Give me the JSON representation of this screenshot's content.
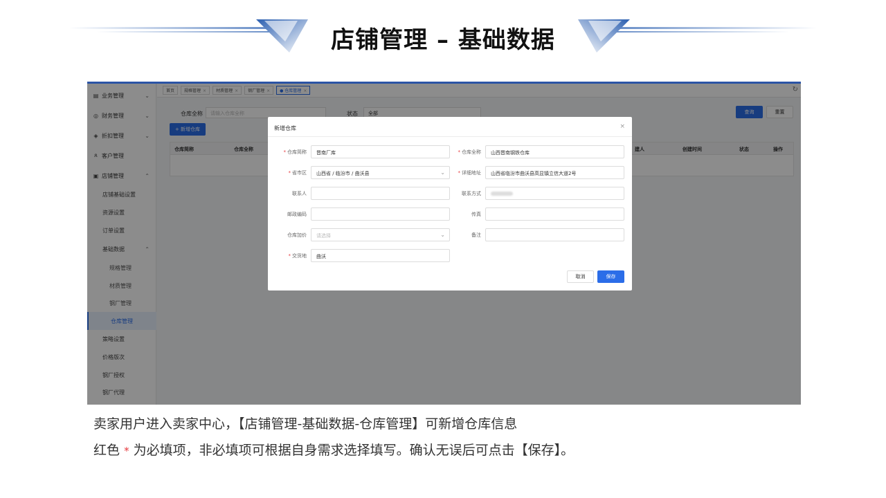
{
  "slide": {
    "title": "店铺管理 – 基础数据",
    "caption_line1": "卖家用户进入卖家中心，【店铺管理-基础数据-仓库管理】可新增仓库信息",
    "caption_line2_prefix": "红色",
    "caption_line2_star": "*",
    "caption_line2_suffix": "为必填项，非必填项可根据自身需求选择填写。确认无误后可点击【保存】。"
  },
  "sidebar": {
    "items": [
      {
        "label": "业务管理",
        "icon": "clipboard-icon",
        "chevron": "⌄"
      },
      {
        "label": "财务管理",
        "icon": "money-icon",
        "chevron": "⌄"
      },
      {
        "label": "折扣管理",
        "icon": "tag-icon",
        "chevron": "⌄"
      },
      {
        "label": "客户管理",
        "icon": "users-icon"
      },
      {
        "label": "店铺管理",
        "icon": "store-icon",
        "chevron": "⌃"
      },
      {
        "label": "店铺基础设置"
      },
      {
        "label": "资源设置"
      },
      {
        "label": "订单设置"
      },
      {
        "label": "基础数据",
        "chevron": "⌃"
      },
      {
        "label": "规格管理"
      },
      {
        "label": "材质管理"
      },
      {
        "label": "钢厂管理"
      },
      {
        "label": "仓库管理"
      },
      {
        "label": "策略设置"
      },
      {
        "label": "价格版次"
      },
      {
        "label": "钢厂授权"
      },
      {
        "label": "钢厂代理"
      }
    ]
  },
  "tabs": [
    {
      "label": "首页"
    },
    {
      "label": "规格管理",
      "close": "×"
    },
    {
      "label": "材质管理",
      "close": "×"
    },
    {
      "label": "钢厂管理",
      "close": "×"
    },
    {
      "label": "● 仓库管理",
      "close": "×"
    }
  ],
  "filter": {
    "name_label": "仓库全称",
    "name_placeholder": "请输入仓库全称",
    "status_label": "状态",
    "status_value": "全部",
    "query_button": "查询",
    "reset_button": "重置",
    "add_button": "+ 新增仓库"
  },
  "table": {
    "headers": [
      "仓库简称",
      "仓库全称",
      "建人",
      "创建时间",
      "状态",
      "操作"
    ]
  },
  "dialog": {
    "title": "新增仓库",
    "close": "×",
    "fields": {
      "short_name": {
        "label": "仓库简称",
        "value": "晋南厂库"
      },
      "full_name": {
        "label": "仓库全称",
        "value": "山西晋南钢铁仓库"
      },
      "region": {
        "label": "省市区",
        "value": "山西省 / 临汾市 / 曲沃县"
      },
      "address": {
        "label": "详细地址",
        "value": "山西省临汾市曲沃县高显镇立信大道2号"
      },
      "contact": {
        "label": "联系人",
        "value": ""
      },
      "phone": {
        "label": "联系方式",
        "value": ""
      },
      "postcode": {
        "label": "邮政编码",
        "value": ""
      },
      "fax": {
        "label": "传真",
        "value": ""
      },
      "markup": {
        "label": "仓库加价",
        "placeholder": "请选择"
      },
      "remark": {
        "label": "备注",
        "value": ""
      },
      "delivery": {
        "label": "交货地",
        "value": "曲沃"
      }
    },
    "cancel_button": "取消",
    "save_button": "保存"
  }
}
